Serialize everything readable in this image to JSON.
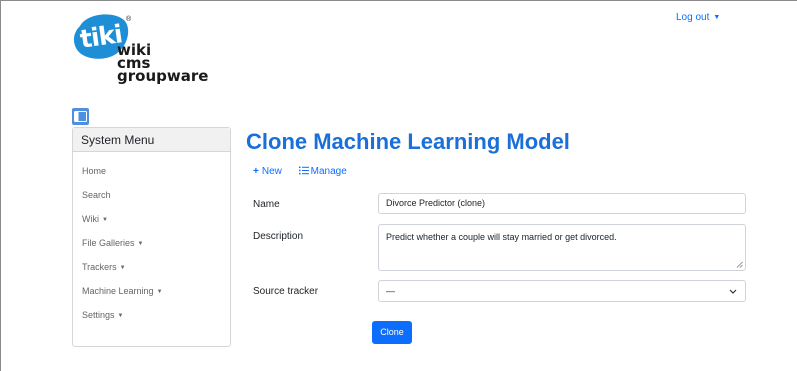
{
  "header": {
    "logo_main": "tiki",
    "logo_lines": [
      "wiki",
      "cms",
      "groupware"
    ],
    "logo_reg": "®",
    "logout_label": "Log out",
    "logo_color": "#1e8fd6"
  },
  "sidebar": {
    "title": "System Menu",
    "items": [
      {
        "label": "Home",
        "has_dropdown": false
      },
      {
        "label": "Search",
        "has_dropdown": false
      },
      {
        "label": "Wiki",
        "has_dropdown": true
      },
      {
        "label": "File Galleries",
        "has_dropdown": true
      },
      {
        "label": "Trackers",
        "has_dropdown": true
      },
      {
        "label": "Machine Learning",
        "has_dropdown": true
      },
      {
        "label": "Settings",
        "has_dropdown": true
      }
    ]
  },
  "main": {
    "title": "Clone Machine Learning Model",
    "actions": {
      "new_label": "New",
      "manage_label": "Manage"
    },
    "form": {
      "name_label": "Name",
      "name_value": "Divorce Predictor (clone)",
      "description_label": "Description",
      "description_value": "Predict whether a couple will stay married or get divorced.",
      "source_label": "Source tracker",
      "source_value": "—"
    },
    "submit_label": "Clone"
  },
  "colors": {
    "accent": "#0d6efd",
    "title": "#1b6fd8"
  }
}
